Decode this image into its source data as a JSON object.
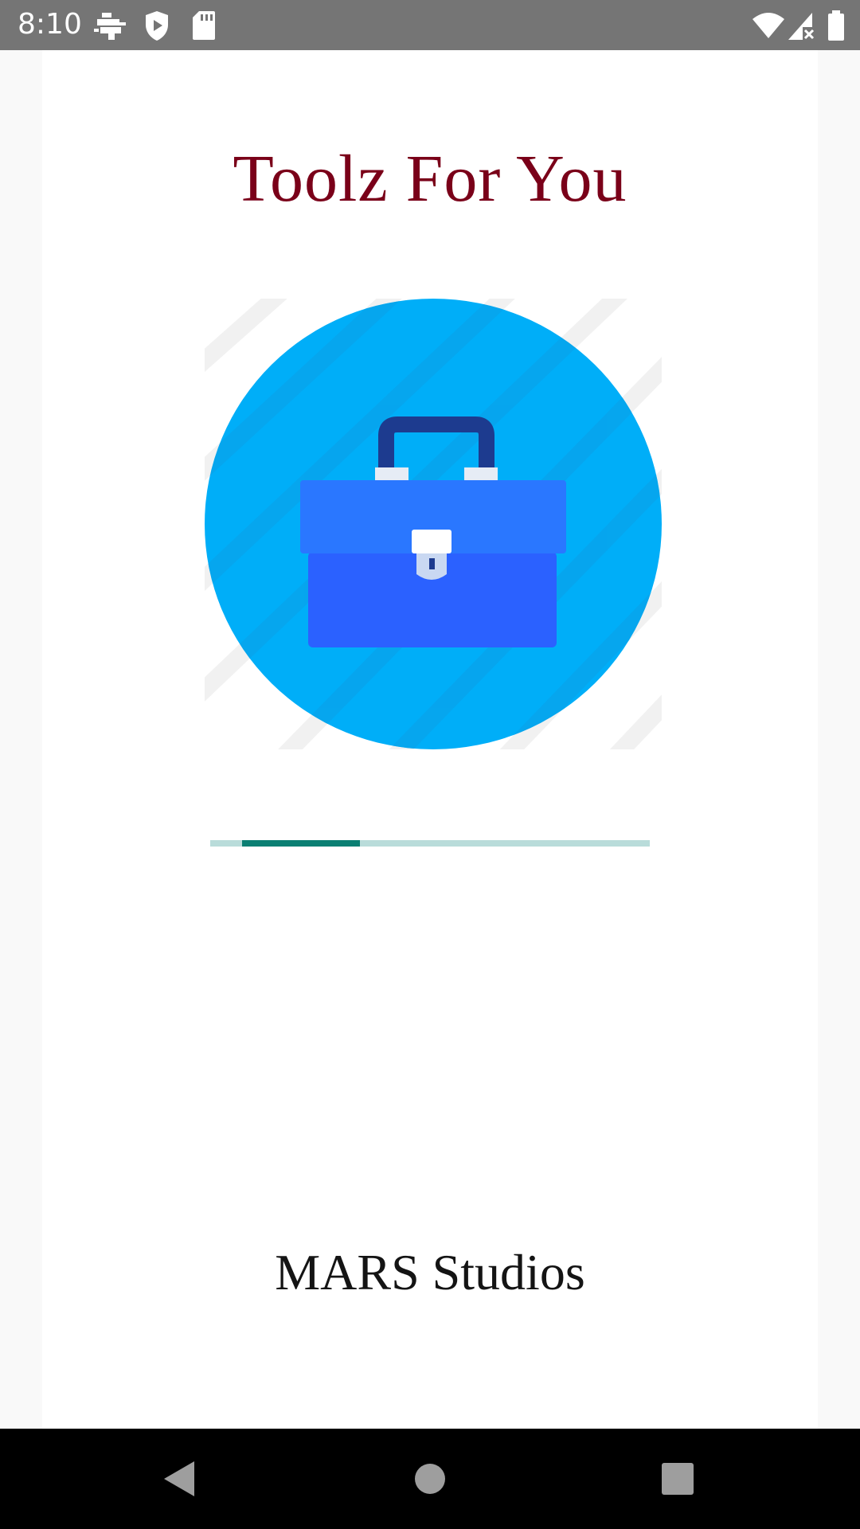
{
  "status_bar": {
    "time": "8:10",
    "icons": [
      "usb-debug-icon",
      "shield-icon",
      "sd-card-icon",
      "wifi-icon",
      "cellular-no-data-icon",
      "battery-icon"
    ]
  },
  "app": {
    "title": "Toolz For You",
    "logo": "toolbox-icon",
    "progress": {
      "type": "indeterminate",
      "track_color": "#b9dcda",
      "fill_color": "#0b7f73"
    },
    "studio": "MARS Studios"
  },
  "colors": {
    "title": "#7a0019",
    "logo_circle": "#00aef8",
    "toolbox_body": "#2b61ff",
    "toolbox_lid": "#2a77ff",
    "toolbox_handle": "#1d3b8f"
  },
  "nav_bar": {
    "buttons": [
      "back-icon",
      "home-icon",
      "recents-icon"
    ]
  }
}
